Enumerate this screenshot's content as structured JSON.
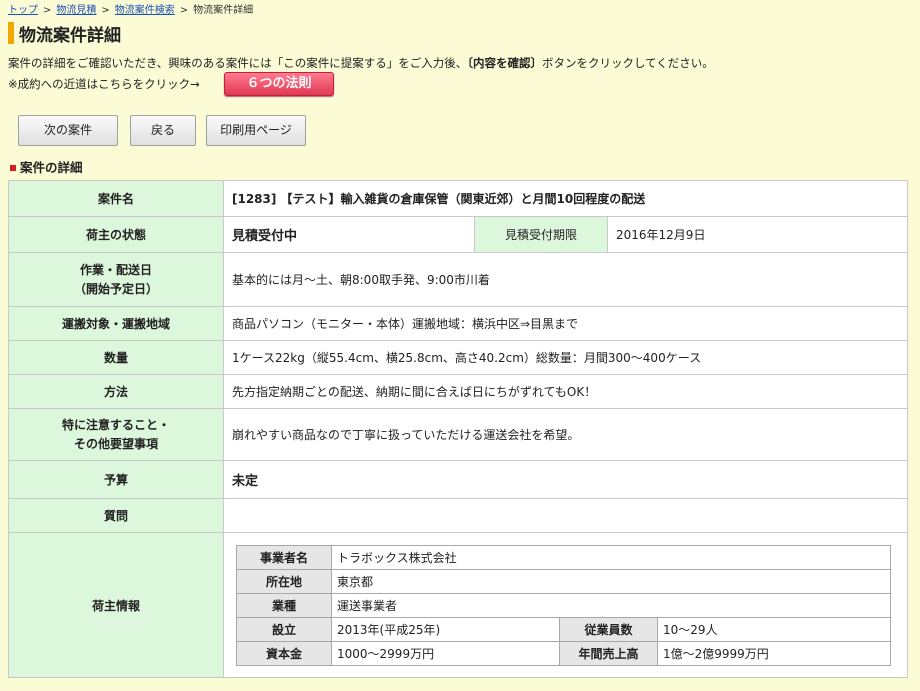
{
  "breadcrumb": {
    "items": [
      "トップ",
      "物流見積",
      "物流案件検索"
    ],
    "current": "物流案件詳細",
    "sep": ">"
  },
  "page_title": "物流案件詳細",
  "intro": {
    "text1": "案件の詳細をご確認いただき、興味のある案件には「この案件に提案する」をご入力後、",
    "bold": "〔内容を確認〕",
    "text2": "ボタンをクリックしてください。"
  },
  "near": {
    "text": "※成約への近道はこちらをクリック→",
    "button": "６つの法則"
  },
  "buttons": {
    "next": "次の案件",
    "back": "戻る",
    "print": "印刷用ページ"
  },
  "section_title": "案件の詳細",
  "detail": {
    "case_name_label": "案件名",
    "case_name": "[1283] 【テスト】輸入雑貨の倉庫保管（関東近郊）と月間10回程度の配送",
    "status_label": "荷主の状態",
    "status": "見積受付中",
    "deadline_label": "見積受付期限",
    "deadline": "2016年12月9日",
    "work_label_1": "作業・配送日",
    "work_label_2": "（開始予定日）",
    "work": "基本的には月～土、朝8:00取手発、9:00市川着",
    "transport_label": "運搬対象・運搬地域",
    "transport": "商品パソコン（モニター・本体）運搬地域：横浜中区⇒目黒まで",
    "quantity_label": "数量",
    "quantity": "1ケース22kg（縦55.4cm、横25.8cm、高さ40.2cm）総数量：月間300～400ケース",
    "method_label": "方法",
    "method": "先方指定納期ごとの配送、納期に間に合えば日にちがずれてもOK！",
    "notes_label_1": "特に注意すること・",
    "notes_label_2": "その他要望事項",
    "notes": "崩れやすい商品なので丁寧に扱っていただける運送会社を希望。",
    "budget_label": "予算",
    "budget": "未定",
    "question_label": "質問",
    "question": "",
    "owner_label": "荷主情報"
  },
  "owner": {
    "company_label": "事業者名",
    "company": "トラボックス株式会社",
    "location_label": "所在地",
    "location": "東京都",
    "industry_label": "業種",
    "industry": "運送事業者",
    "founded_label": "設立",
    "founded": "2013年(平成25年)",
    "employees_label": "従業員数",
    "employees": "10～29人",
    "capital_label": "資本金",
    "capital": "1000～2999万円",
    "sales_label": "年間売上高",
    "sales": "1億～2億9999万円"
  }
}
